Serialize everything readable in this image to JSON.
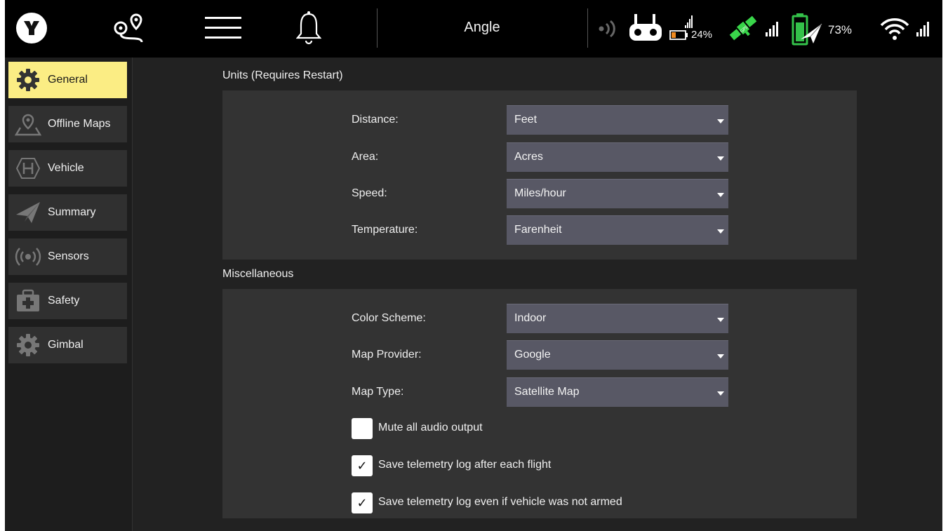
{
  "toolbar": {
    "flight_mode": "Angle",
    "remote_battery": "24%",
    "vehicle_battery": "73%",
    "icons": [
      "app-logo-icon",
      "plan-view-icon",
      "menu-icon",
      "bell-icon",
      "rc-rssi-icon",
      "joystick-icon",
      "gps-icon",
      "battery-icon",
      "wifi-icon"
    ]
  },
  "sidebar": {
    "items": [
      {
        "label": "General",
        "icon": "gear-icon",
        "active": true
      },
      {
        "label": "Offline Maps",
        "icon": "map-pin-icon",
        "active": false
      },
      {
        "label": "Vehicle",
        "icon": "vehicle-icon",
        "active": false
      },
      {
        "label": "Summary",
        "icon": "paper-plane-icon",
        "active": false
      },
      {
        "label": "Sensors",
        "icon": "sensor-icon",
        "active": false
      },
      {
        "label": "Safety",
        "icon": "first-aid-kit-icon",
        "active": false
      },
      {
        "label": "Gimbal",
        "icon": "gear-icon",
        "active": false
      }
    ]
  },
  "units": {
    "title": "Units (Requires Restart)",
    "distance": {
      "label": "Distance:",
      "value": "Feet"
    },
    "area": {
      "label": "Area:",
      "value": "Acres"
    },
    "speed": {
      "label": "Speed:",
      "value": "Miles/hour"
    },
    "temperature": {
      "label": "Temperature:",
      "value": "Farenheit"
    }
  },
  "misc": {
    "title": "Miscellaneous",
    "color_scheme": {
      "label": "Color Scheme:",
      "value": "Indoor"
    },
    "map_provider": {
      "label": "Map Provider:",
      "value": "Google"
    },
    "map_type": {
      "label": "Map Type:",
      "value": "Satellite Map"
    },
    "mute_audio": {
      "label": "Mute all audio output",
      "checked": false
    },
    "save_log": {
      "label": "Save telemetry log after each flight",
      "checked": true
    },
    "save_log_unarmed": {
      "label": "Save telemetry log even if vehicle was not armed",
      "checked": true
    }
  },
  "colors": {
    "accent": "#fbed84",
    "gps_green": "#39d64a",
    "battery_green": "#34c24a",
    "battery_orange": "#f08a1e",
    "toolbar_bg": "#000000",
    "panel_bg": "#333333",
    "combo_bg": "#585865"
  }
}
